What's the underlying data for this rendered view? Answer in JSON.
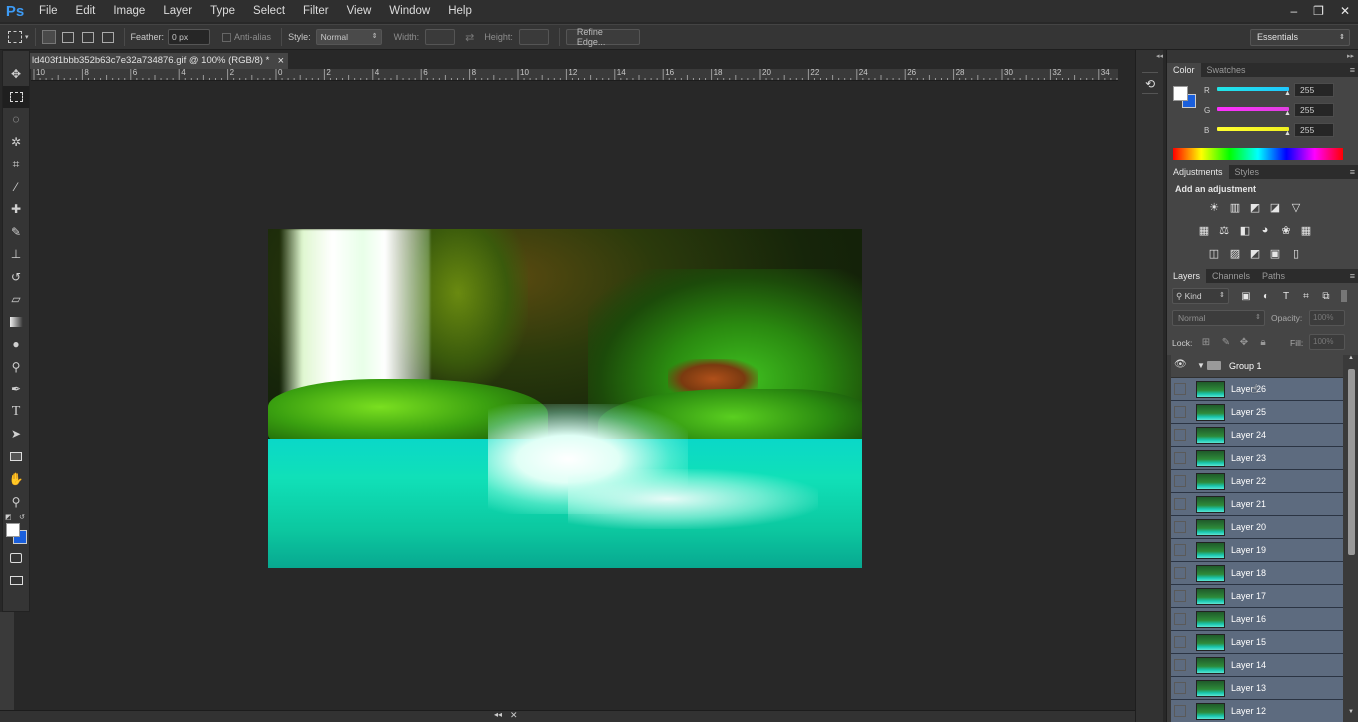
{
  "app": {
    "logo": "Ps",
    "menus": [
      "File",
      "Edit",
      "Image",
      "Layer",
      "Type",
      "Select",
      "Filter",
      "View",
      "Window",
      "Help"
    ],
    "window_controls": [
      "–",
      "❐",
      "✕"
    ]
  },
  "options_bar": {
    "feather_label": "Feather:",
    "feather_value": "0 px",
    "anti_alias_label": "Anti-alias",
    "style_label": "Style:",
    "style_value": "Normal",
    "width_label": "Width:",
    "height_label": "Height:",
    "refine_edge_label": "Refine Edge...",
    "workspace": "Essentials"
  },
  "document": {
    "tab_title": "ld403f1bbb352b63c7e32a734876.gif @ 100% (RGB/8) *",
    "close_icon": "×",
    "ruler_labels": [
      "10",
      "8",
      "6",
      "4",
      "2",
      "0",
      "2",
      "4",
      "6",
      "8",
      "10",
      "12",
      "14",
      "16",
      "18",
      "20",
      "22",
      "24",
      "26",
      "28",
      "30",
      "32",
      "34"
    ]
  },
  "color_panel": {
    "tabs": [
      "Color",
      "Swatches"
    ],
    "channels": [
      {
        "label": "R",
        "value": "255",
        "color": "#22c8e6"
      },
      {
        "label": "G",
        "value": "255",
        "color": "#e03fd0"
      },
      {
        "label": "B",
        "value": "255",
        "color": "#e6e62a"
      }
    ],
    "foreground": "#ffffff",
    "background": "#1a5fdc"
  },
  "adjustments_panel": {
    "tabs": [
      "Adjustments",
      "Styles"
    ],
    "heading": "Add an adjustment"
  },
  "layers_panel": {
    "tabs": [
      "Layers",
      "Channels",
      "Paths"
    ],
    "kind_label": "Kind",
    "blend_mode": "Normal",
    "opacity_label": "Opacity:",
    "opacity_value": "100%",
    "lock_label": "Lock:",
    "fill_label": "Fill:",
    "fill_value": "100%",
    "group_name": "Group 1",
    "layers": [
      "Layer 26",
      "Layer 25",
      "Layer 24",
      "Layer 23",
      "Layer 22",
      "Layer 21",
      "Layer 20",
      "Layer 19",
      "Layer 18",
      "Layer 17",
      "Layer 16",
      "Layer 15",
      "Layer 14",
      "Layer 13",
      "Layer 12"
    ]
  }
}
